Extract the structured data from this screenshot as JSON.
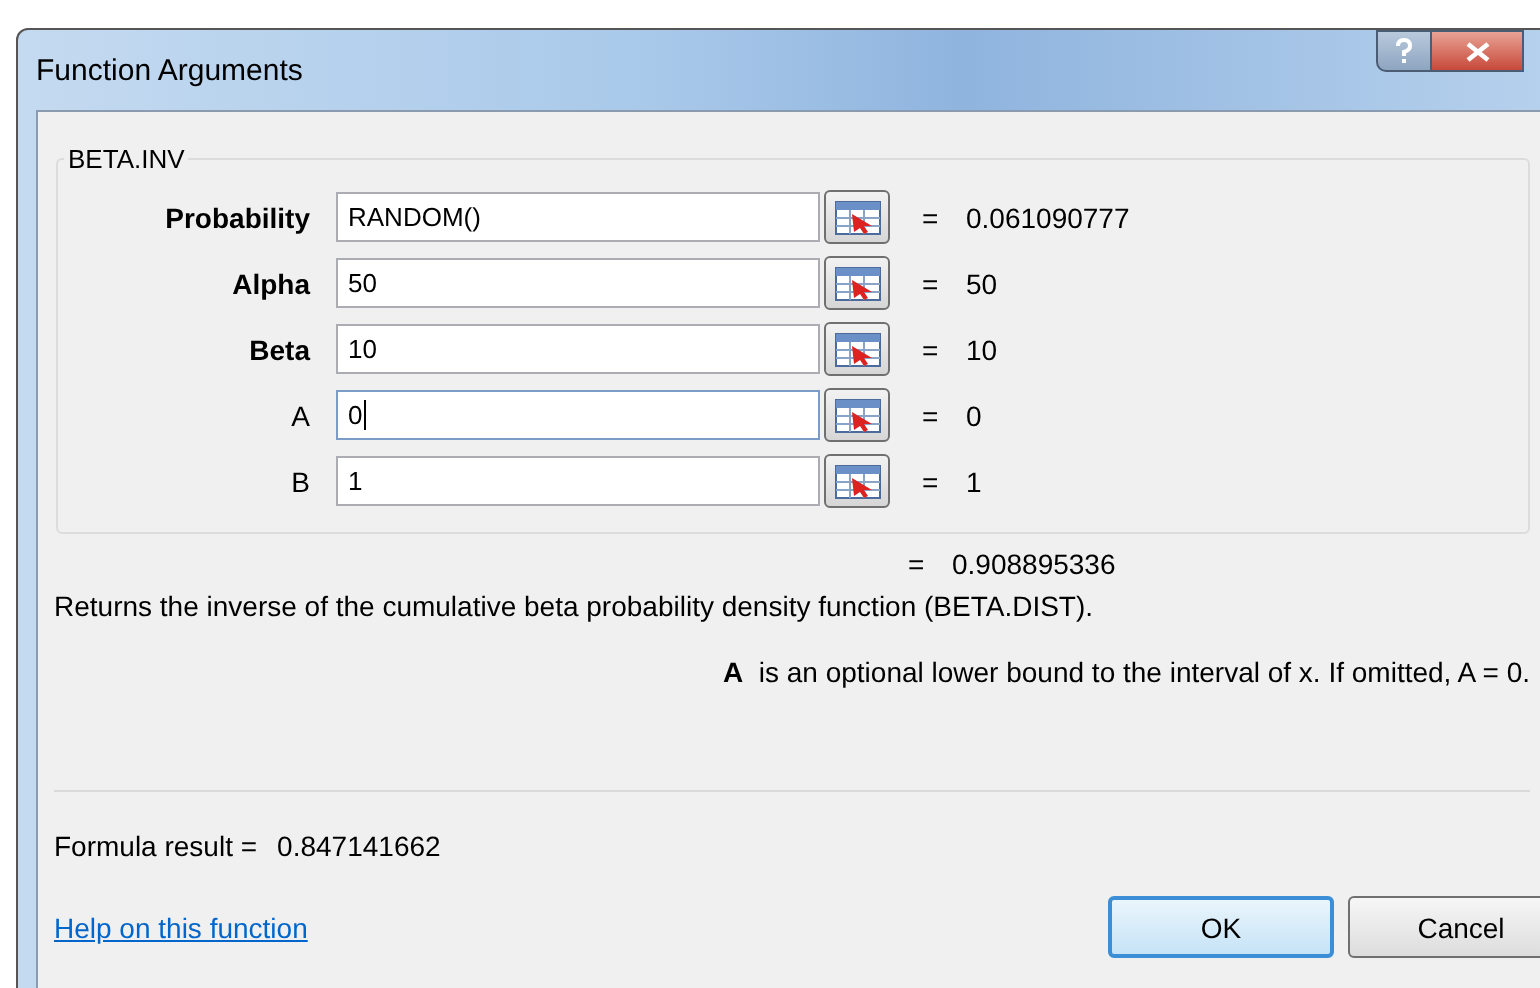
{
  "window": {
    "title": "Function Arguments"
  },
  "function": {
    "name": "BETA.INV",
    "arguments": [
      {
        "label": "Probability",
        "required": true,
        "value": "RANDOM()",
        "focused": false,
        "sign": "=",
        "result": "0.061090777"
      },
      {
        "label": "Alpha",
        "required": true,
        "value": "50",
        "focused": false,
        "sign": "=",
        "result": "50"
      },
      {
        "label": "Beta",
        "required": true,
        "value": "10",
        "focused": false,
        "sign": "=",
        "result": "10"
      },
      {
        "label": "A",
        "required": false,
        "value": "0",
        "focused": true,
        "sign": "=",
        "result": "0"
      },
      {
        "label": "B",
        "required": false,
        "value": "1",
        "focused": false,
        "sign": "=",
        "result": "1"
      }
    ],
    "result_sign": "=",
    "result": "0.908895336"
  },
  "description": "Returns the inverse of the cumulative beta probability density function (BETA.DIST).",
  "argument_help": "**A**  is an optional lower bound to the interval of x. If omitted, A = 0.",
  "formula_result": {
    "label": "Formula result =",
    "value": "0.847141662"
  },
  "help_link": "Help on this function",
  "buttons": [
    {
      "label": "OK",
      "default": true
    },
    {
      "label": "Cancel",
      "default": false
    }
  ]
}
